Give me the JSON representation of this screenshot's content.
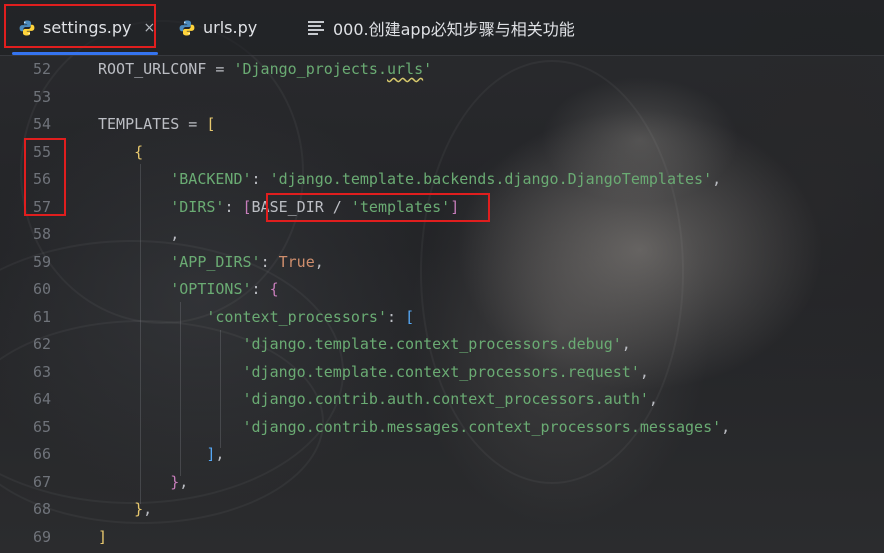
{
  "tabs": [
    {
      "label": "settings.py",
      "icon": "python-file-icon",
      "active": true,
      "closable": true
    },
    {
      "label": "urls.py",
      "icon": "python-file-icon",
      "active": false,
      "closable": false
    },
    {
      "label": "000.创建app必知步骤与相关功能",
      "icon": "text-file-icon",
      "active": false,
      "closable": false
    }
  ],
  "tab_close_glyph": "×",
  "editor": {
    "lines": [
      {
        "num": "52",
        "tokens": [
          {
            "t": "ROOT_URLCONF = ",
            "c": "plain"
          },
          {
            "t": "'Django_projects.",
            "c": "str"
          },
          {
            "t": "urls",
            "c": "str ul"
          },
          {
            "t": "'",
            "c": "str"
          }
        ]
      },
      {
        "num": "53",
        "tokens": []
      },
      {
        "num": "54",
        "tokens": [
          {
            "t": "TEMPLATES = ",
            "c": "plain"
          },
          {
            "t": "[",
            "c": "br1"
          }
        ]
      },
      {
        "num": "55",
        "tokens": [
          {
            "t": "    ",
            "c": "plain"
          },
          {
            "t": "{",
            "c": "br1"
          }
        ]
      },
      {
        "num": "56",
        "tokens": [
          {
            "t": "        ",
            "c": "plain"
          },
          {
            "t": "'BACKEND'",
            "c": "str"
          },
          {
            "t": ": ",
            "c": "plain"
          },
          {
            "t": "'django.template.backends.django.DjangoTemplates'",
            "c": "str"
          },
          {
            "t": ",",
            "c": "plain"
          }
        ]
      },
      {
        "num": "57",
        "tokens": [
          {
            "t": "        ",
            "c": "plain"
          },
          {
            "t": "'DIRS'",
            "c": "str"
          },
          {
            "t": ": ",
            "c": "plain"
          },
          {
            "t": "[",
            "c": "br2"
          },
          {
            "t": "BASE_DIR / ",
            "c": "plain"
          },
          {
            "t": "'templates'",
            "c": "str"
          },
          {
            "t": "]",
            "c": "br2"
          }
        ]
      },
      {
        "num": "58",
        "tokens": [
          {
            "t": "        ,",
            "c": "plain"
          }
        ]
      },
      {
        "num": "59",
        "tokens": [
          {
            "t": "        ",
            "c": "plain"
          },
          {
            "t": "'APP_DIRS'",
            "c": "str"
          },
          {
            "t": ": ",
            "c": "plain"
          },
          {
            "t": "True",
            "c": "kw"
          },
          {
            "t": ",",
            "c": "plain"
          }
        ]
      },
      {
        "num": "60",
        "tokens": [
          {
            "t": "        ",
            "c": "plain"
          },
          {
            "t": "'OPTIONS'",
            "c": "str"
          },
          {
            "t": ": ",
            "c": "plain"
          },
          {
            "t": "{",
            "c": "br2"
          }
        ]
      },
      {
        "num": "61",
        "tokens": [
          {
            "t": "            ",
            "c": "plain"
          },
          {
            "t": "'context_processors'",
            "c": "str"
          },
          {
            "t": ": ",
            "c": "plain"
          },
          {
            "t": "[",
            "c": "br3"
          }
        ]
      },
      {
        "num": "62",
        "tokens": [
          {
            "t": "                ",
            "c": "plain"
          },
          {
            "t": "'django.template.context_processors.debug'",
            "c": "str"
          },
          {
            "t": ",",
            "c": "plain"
          }
        ]
      },
      {
        "num": "63",
        "tokens": [
          {
            "t": "                ",
            "c": "plain"
          },
          {
            "t": "'django.template.context_processors.request'",
            "c": "str"
          },
          {
            "t": ",",
            "c": "plain"
          }
        ]
      },
      {
        "num": "64",
        "tokens": [
          {
            "t": "                ",
            "c": "plain"
          },
          {
            "t": "'django.contrib.auth.context_processors.auth'",
            "c": "str"
          },
          {
            "t": ",",
            "c": "plain"
          }
        ]
      },
      {
        "num": "65",
        "tokens": [
          {
            "t": "                ",
            "c": "plain"
          },
          {
            "t": "'django.contrib.messages.context_processors.messages'",
            "c": "str"
          },
          {
            "t": ",",
            "c": "plain"
          }
        ]
      },
      {
        "num": "66",
        "tokens": [
          {
            "t": "            ",
            "c": "plain"
          },
          {
            "t": "]",
            "c": "br3"
          },
          {
            "t": ",",
            "c": "plain"
          }
        ]
      },
      {
        "num": "67",
        "tokens": [
          {
            "t": "        ",
            "c": "plain"
          },
          {
            "t": "}",
            "c": "br2"
          },
          {
            "t": ",",
            "c": "plain"
          }
        ]
      },
      {
        "num": "68",
        "tokens": [
          {
            "t": "    ",
            "c": "plain"
          },
          {
            "t": "}",
            "c": "br1"
          },
          {
            "t": ",",
            "c": "plain"
          }
        ]
      },
      {
        "num": "69",
        "tokens": [
          {
            "t": "]",
            "c": "br1"
          }
        ]
      }
    ]
  },
  "colors": {
    "accent": "#3574f0",
    "highlight_box": "#e01e1e",
    "string": "#6aab73",
    "keyword": "#cf8e6d"
  }
}
